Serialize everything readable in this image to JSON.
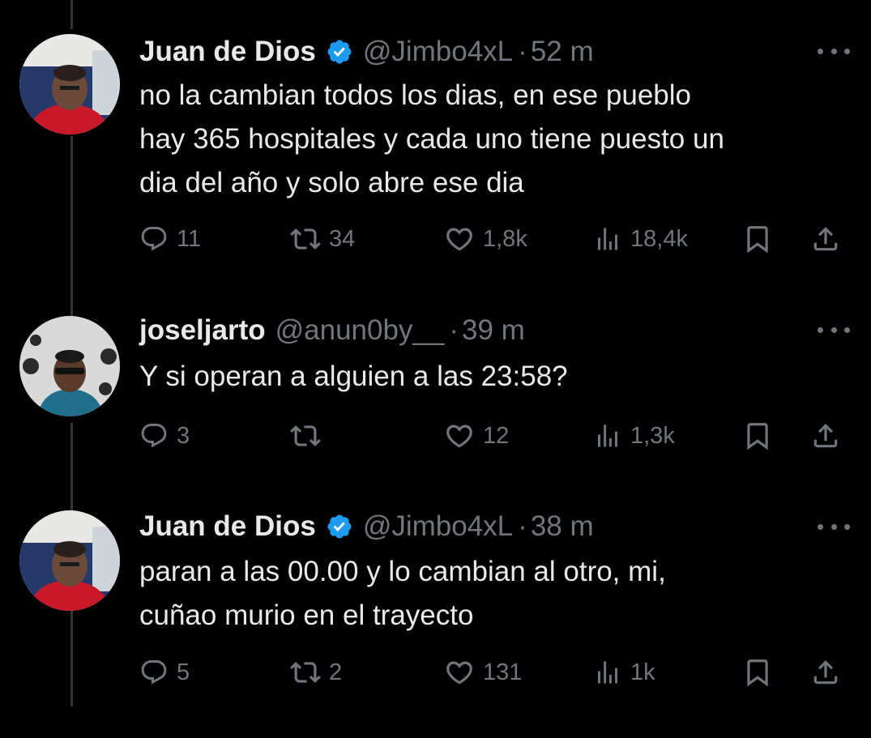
{
  "tweets": [
    {
      "name": "Juan de Dios",
      "verified": true,
      "handle": "@Jimbo4xL",
      "separator": "·",
      "time": "52 m",
      "lines": [
        "no la cambian todos los dias, en ese pueblo",
        "hay 365 hospitales y cada uno tiene puesto un",
        "dia del año y solo abre ese dia"
      ],
      "replies": "11",
      "retweets": "34",
      "likes": "1,8k",
      "views": "18,4k"
    },
    {
      "name": "joseljarto",
      "verified": false,
      "handle": "@anun0by__",
      "separator": "·",
      "time": "39 m",
      "lines": [
        "Y si operan a alguien a las 23:58?"
      ],
      "replies": "3",
      "retweets": "",
      "likes": "12",
      "views": "1,3k"
    },
    {
      "name": "Juan de Dios",
      "verified": true,
      "handle": "@Jimbo4xL",
      "separator": "·",
      "time": "38 m",
      "lines": [
        "paran a las 00.00 y lo cambian al otro, mi,",
        "cuñao murio en el trayecto"
      ],
      "replies": "5",
      "retweets": "2",
      "likes": "131",
      "views": "1k"
    }
  ],
  "icons": {
    "reply": "reply-icon",
    "retweet": "retweet-icon",
    "like": "heart-icon",
    "views": "views-icon",
    "bookmark": "bookmark-icon",
    "share": "share-icon",
    "more": "more-icon",
    "verified": "verified-badge-icon"
  },
  "colors": {
    "background": "#000000",
    "text": "#e7e9ea",
    "muted": "#71767b",
    "verified": "#1d9bf0",
    "thread_line": "#333639"
  }
}
